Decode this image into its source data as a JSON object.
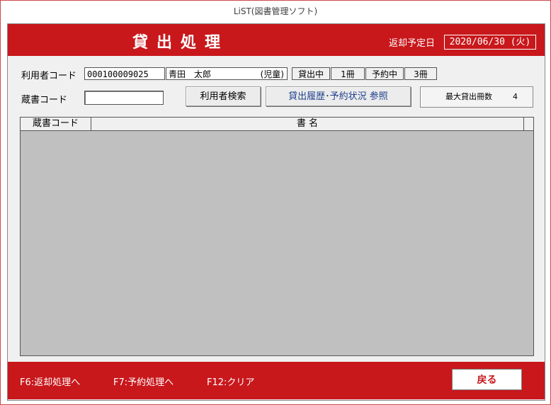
{
  "window": {
    "title": "LiST(図書管理ソフト)"
  },
  "header": {
    "title": "貸出処理",
    "due_label": "返却予定日",
    "due_value": "2020/06/30 (火)"
  },
  "user": {
    "label": "利用者コード",
    "code": "000100009025",
    "name": "青田　太郎",
    "category": "(児童)",
    "loan_label": "貸出中",
    "loan_count": "1冊",
    "reserve_label": "予約中",
    "reserve_count": "3冊"
  },
  "book": {
    "label": "蔵書コード",
    "value": ""
  },
  "buttons": {
    "user_search": "利用者検索",
    "history": "貸出履歴･予約状況  参照"
  },
  "info": {
    "max_label": "最大貸出冊数",
    "max_value": "4"
  },
  "grid": {
    "columns": [
      "蔵書コード",
      "書 名"
    ],
    "rows": []
  },
  "footer": {
    "f6": "F6:返却処理へ",
    "f7": "F7:予約処理へ",
    "f12": "F12:クリア",
    "back": "戻る"
  },
  "colors": {
    "accent": "#c8181c",
    "panel": "#f0f0f0",
    "grid": "#c0c0c0"
  }
}
